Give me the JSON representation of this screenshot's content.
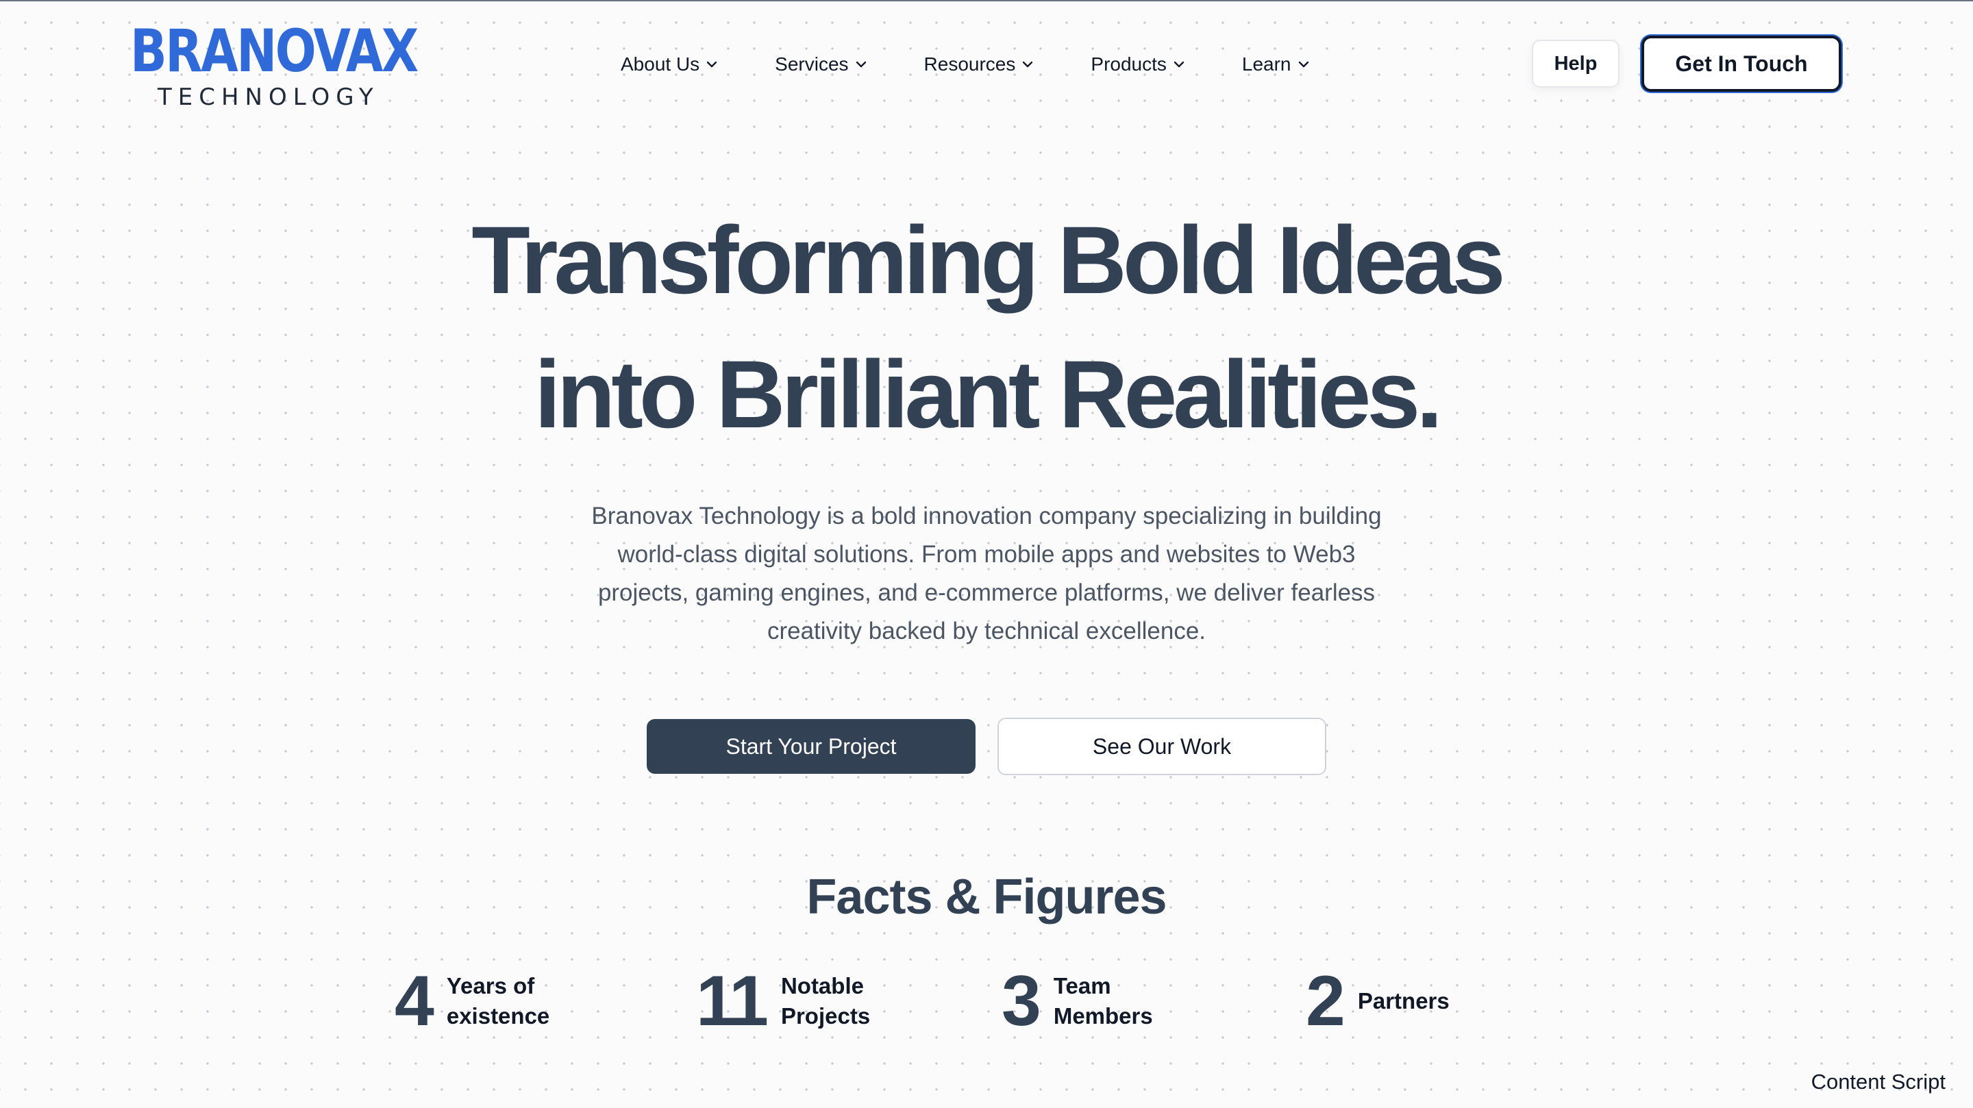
{
  "brand": {
    "name": "BRANOVAX",
    "tagline": "TECHNOLOGY",
    "color": "#2f6ad8"
  },
  "nav": {
    "items": [
      {
        "label": "About Us"
      },
      {
        "label": "Services"
      },
      {
        "label": "Resources"
      },
      {
        "label": "Products"
      },
      {
        "label": "Learn"
      }
    ],
    "chevron_icon": "chevron-down-icon"
  },
  "header": {
    "help_label": "Help",
    "cta_label": "Get In Touch"
  },
  "hero": {
    "title_line1": "Transforming Bold Ideas",
    "title_line2": "into Brilliant Realities.",
    "description": "Branovax Technology is a bold innovation company specializing in building world-class digital solutions. From mobile apps and websites to Web3 projects, gaming engines, and e-commerce platforms, we deliver fearless creativity backed by technical excellence.",
    "primary_button": "Start Your Project",
    "secondary_button": "See Our Work"
  },
  "facts": {
    "title": "Facts & Figures",
    "items": [
      {
        "number": "4",
        "label": "Years of existence"
      },
      {
        "number": "11",
        "label": "Notable Projects"
      },
      {
        "number": "3",
        "label": "Team Members"
      },
      {
        "number": "2",
        "label": "Partners"
      }
    ]
  },
  "overlay": {
    "label": "Content Script"
  },
  "colors": {
    "primary_dark": "#334155",
    "accent": "#2f6ad8",
    "background": "#fbfbfc"
  }
}
